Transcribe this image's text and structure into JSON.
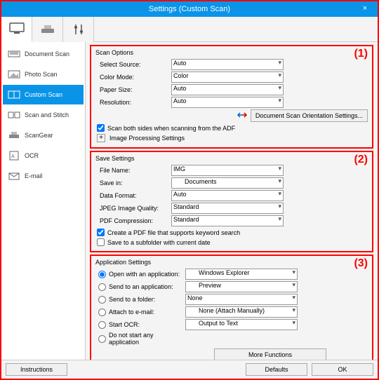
{
  "window": {
    "title": "Settings (Custom Scan)",
    "close_glyph": "×"
  },
  "mode_tabs": [
    {
      "id": "scan-from-computer",
      "active": true
    },
    {
      "id": "scan-from-panel",
      "active": false
    },
    {
      "id": "preferences",
      "active": false
    }
  ],
  "sidebar": {
    "items": [
      {
        "id": "document-scan",
        "label": "Document Scan",
        "active": false
      },
      {
        "id": "photo-scan",
        "label": "Photo Scan",
        "active": false
      },
      {
        "id": "custom-scan",
        "label": "Custom Scan",
        "active": true
      },
      {
        "id": "scan-stitch",
        "label": "Scan and Stitch",
        "active": false
      },
      {
        "id": "scangear",
        "label": "ScanGear",
        "active": false
      },
      {
        "id": "ocr",
        "label": "OCR",
        "active": false
      },
      {
        "id": "email",
        "label": "E-mail",
        "active": false
      }
    ]
  },
  "scan_options": {
    "title": "Scan Options",
    "select_source_label": "Select Source:",
    "select_source_value": "Auto",
    "color_mode_label": "Color Mode:",
    "color_mode_value": "Color",
    "paper_size_label": "Paper Size:",
    "paper_size_value": "Auto",
    "resolution_label": "Resolution:",
    "resolution_value": "Auto",
    "orientation_btn": "Document Scan Orientation Settings...",
    "scan_both_label": "Scan both sides when scanning from the ADF",
    "scan_both_checked": true,
    "img_proc_label": "Image Processing Settings"
  },
  "save_settings": {
    "title": "Save Settings",
    "file_name_label": "File Name:",
    "file_name_value": "IMG",
    "save_in_label": "Save in:",
    "save_in_value": "Documents",
    "data_format_label": "Data Format:",
    "data_format_value": "Auto",
    "jpeg_quality_label": "JPEG Image Quality:",
    "jpeg_quality_value": "Standard",
    "pdf_compress_label": "PDF Compression:",
    "pdf_compress_value": "Standard",
    "keyword_search_label": "Create a PDF file that supports keyword search",
    "keyword_search_checked": true,
    "subfolder_label": "Save to a subfolder with current date",
    "subfolder_checked": false
  },
  "app_settings": {
    "title": "Application Settings",
    "options": [
      {
        "id": "open-app",
        "label": "Open with an application:",
        "selected": true,
        "value": "Windows Explorer",
        "icon": "app"
      },
      {
        "id": "send-app",
        "label": "Send to an application:",
        "selected": false,
        "value": "Preview",
        "icon": "folder"
      },
      {
        "id": "send-folder",
        "label": "Send to a folder:",
        "selected": false,
        "value": "None",
        "icon": null
      },
      {
        "id": "attach-mail",
        "label": "Attach to e-mail:",
        "selected": false,
        "value": "None (Attach Manually)",
        "icon": "folder"
      },
      {
        "id": "start-ocr",
        "label": "Start OCR:",
        "selected": false,
        "value": "Output to Text",
        "icon": "doc"
      },
      {
        "id": "no-app",
        "label": "Do not start any application",
        "selected": false,
        "value": null,
        "icon": null
      }
    ],
    "more_functions_btn": "More Functions"
  },
  "footer": {
    "instructions": "Instructions",
    "defaults": "Defaults",
    "ok": "OK"
  },
  "annotations": {
    "one": "(1)",
    "two": "(2)",
    "three": "(3)"
  }
}
